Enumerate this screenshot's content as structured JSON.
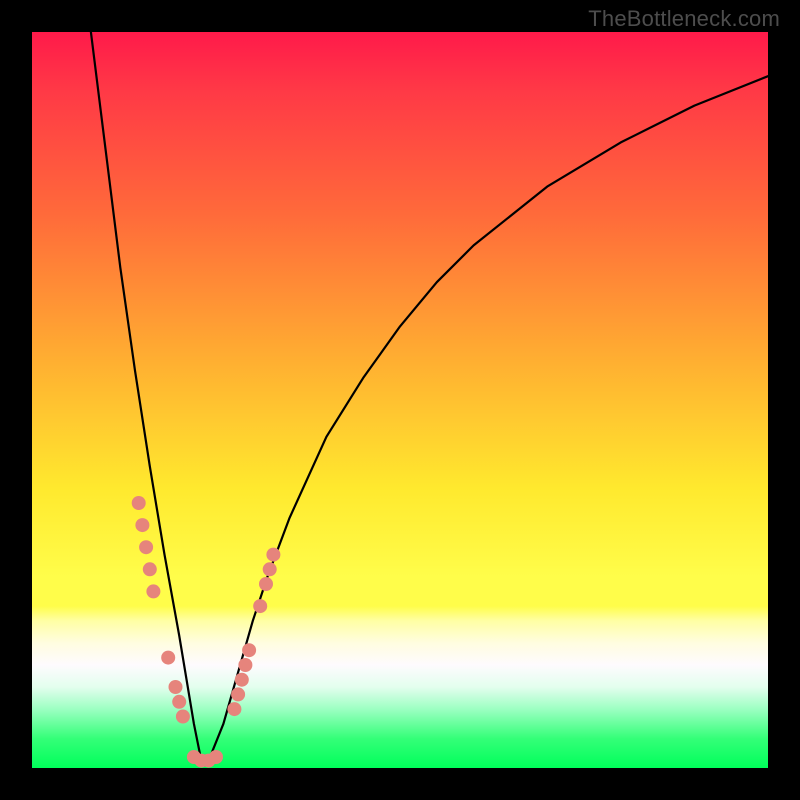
{
  "watermark": "TheBottleneck.com",
  "chart_data": {
    "type": "line",
    "title": "",
    "xlabel": "",
    "ylabel": "",
    "xlim": [
      0,
      100
    ],
    "ylim": [
      0,
      100
    ],
    "background_gradient": {
      "top_color": "#ff1a4a",
      "mid_color": "#ffe92e",
      "bottom_color": "#00ff5a",
      "meaning": "red=high bottleneck, green=no bottleneck"
    },
    "series": [
      {
        "name": "bottleneck-curve",
        "description": "V-shaped bottleneck percentage curve; minimum near x≈23",
        "x": [
          8,
          10,
          12,
          14,
          16,
          18,
          20,
          22,
          23,
          24,
          26,
          28,
          30,
          32,
          35,
          40,
          45,
          50,
          55,
          60,
          70,
          80,
          90,
          100
        ],
        "values": [
          100,
          84,
          68,
          54,
          41,
          29,
          18,
          6,
          1,
          1,
          6,
          13,
          20,
          26,
          34,
          45,
          53,
          60,
          66,
          71,
          79,
          85,
          90,
          94
        ]
      }
    ],
    "markers": {
      "name": "highlighted-points",
      "description": "Salmon dot clusters on either arm of the V near the trough",
      "points": [
        {
          "x": 14.5,
          "y": 36
        },
        {
          "x": 15.0,
          "y": 33
        },
        {
          "x": 15.5,
          "y": 30
        },
        {
          "x": 16.0,
          "y": 27
        },
        {
          "x": 16.5,
          "y": 24
        },
        {
          "x": 18.5,
          "y": 15
        },
        {
          "x": 19.5,
          "y": 11
        },
        {
          "x": 20.0,
          "y": 9
        },
        {
          "x": 20.5,
          "y": 7
        },
        {
          "x": 22.0,
          "y": 1.5
        },
        {
          "x": 23.0,
          "y": 1
        },
        {
          "x": 24.0,
          "y": 1
        },
        {
          "x": 25.0,
          "y": 1.5
        },
        {
          "x": 27.5,
          "y": 8
        },
        {
          "x": 28.0,
          "y": 10
        },
        {
          "x": 28.5,
          "y": 12
        },
        {
          "x": 29.0,
          "y": 14
        },
        {
          "x": 29.5,
          "y": 16
        },
        {
          "x": 31.0,
          "y": 22
        },
        {
          "x": 31.8,
          "y": 25
        },
        {
          "x": 32.3,
          "y": 27
        },
        {
          "x": 32.8,
          "y": 29
        }
      ]
    }
  }
}
